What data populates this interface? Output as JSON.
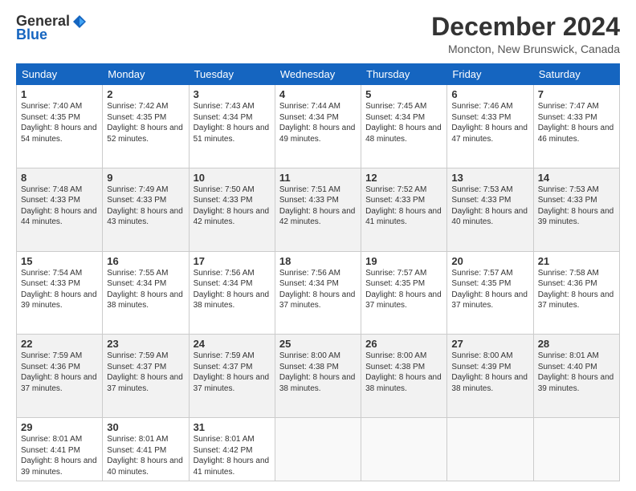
{
  "header": {
    "logo_general": "General",
    "logo_blue": "Blue",
    "title": "December 2024",
    "subtitle": "Moncton, New Brunswick, Canada"
  },
  "calendar": {
    "days_of_week": [
      "Sunday",
      "Monday",
      "Tuesday",
      "Wednesday",
      "Thursday",
      "Friday",
      "Saturday"
    ],
    "weeks": [
      [
        {
          "day": "1",
          "sunrise": "7:40 AM",
          "sunset": "4:35 PM",
          "daylight": "8 hours and 54 minutes."
        },
        {
          "day": "2",
          "sunrise": "7:42 AM",
          "sunset": "4:35 PM",
          "daylight": "8 hours and 52 minutes."
        },
        {
          "day": "3",
          "sunrise": "7:43 AM",
          "sunset": "4:34 PM",
          "daylight": "8 hours and 51 minutes."
        },
        {
          "day": "4",
          "sunrise": "7:44 AM",
          "sunset": "4:34 PM",
          "daylight": "8 hours and 49 minutes."
        },
        {
          "day": "5",
          "sunrise": "7:45 AM",
          "sunset": "4:34 PM",
          "daylight": "8 hours and 48 minutes."
        },
        {
          "day": "6",
          "sunrise": "7:46 AM",
          "sunset": "4:33 PM",
          "daylight": "8 hours and 47 minutes."
        },
        {
          "day": "7",
          "sunrise": "7:47 AM",
          "sunset": "4:33 PM",
          "daylight": "8 hours and 46 minutes."
        }
      ],
      [
        {
          "day": "8",
          "sunrise": "7:48 AM",
          "sunset": "4:33 PM",
          "daylight": "8 hours and 44 minutes."
        },
        {
          "day": "9",
          "sunrise": "7:49 AM",
          "sunset": "4:33 PM",
          "daylight": "8 hours and 43 minutes."
        },
        {
          "day": "10",
          "sunrise": "7:50 AM",
          "sunset": "4:33 PM",
          "daylight": "8 hours and 42 minutes."
        },
        {
          "day": "11",
          "sunrise": "7:51 AM",
          "sunset": "4:33 PM",
          "daylight": "8 hours and 42 minutes."
        },
        {
          "day": "12",
          "sunrise": "7:52 AM",
          "sunset": "4:33 PM",
          "daylight": "8 hours and 41 minutes."
        },
        {
          "day": "13",
          "sunrise": "7:53 AM",
          "sunset": "4:33 PM",
          "daylight": "8 hours and 40 minutes."
        },
        {
          "day": "14",
          "sunrise": "7:53 AM",
          "sunset": "4:33 PM",
          "daylight": "8 hours and 39 minutes."
        }
      ],
      [
        {
          "day": "15",
          "sunrise": "7:54 AM",
          "sunset": "4:33 PM",
          "daylight": "8 hours and 39 minutes."
        },
        {
          "day": "16",
          "sunrise": "7:55 AM",
          "sunset": "4:34 PM",
          "daylight": "8 hours and 38 minutes."
        },
        {
          "day": "17",
          "sunrise": "7:56 AM",
          "sunset": "4:34 PM",
          "daylight": "8 hours and 38 minutes."
        },
        {
          "day": "18",
          "sunrise": "7:56 AM",
          "sunset": "4:34 PM",
          "daylight": "8 hours and 37 minutes."
        },
        {
          "day": "19",
          "sunrise": "7:57 AM",
          "sunset": "4:35 PM",
          "daylight": "8 hours and 37 minutes."
        },
        {
          "day": "20",
          "sunrise": "7:57 AM",
          "sunset": "4:35 PM",
          "daylight": "8 hours and 37 minutes."
        },
        {
          "day": "21",
          "sunrise": "7:58 AM",
          "sunset": "4:36 PM",
          "daylight": "8 hours and 37 minutes."
        }
      ],
      [
        {
          "day": "22",
          "sunrise": "7:59 AM",
          "sunset": "4:36 PM",
          "daylight": "8 hours and 37 minutes."
        },
        {
          "day": "23",
          "sunrise": "7:59 AM",
          "sunset": "4:37 PM",
          "daylight": "8 hours and 37 minutes."
        },
        {
          "day": "24",
          "sunrise": "7:59 AM",
          "sunset": "4:37 PM",
          "daylight": "8 hours and 37 minutes."
        },
        {
          "day": "25",
          "sunrise": "8:00 AM",
          "sunset": "4:38 PM",
          "daylight": "8 hours and 38 minutes."
        },
        {
          "day": "26",
          "sunrise": "8:00 AM",
          "sunset": "4:38 PM",
          "daylight": "8 hours and 38 minutes."
        },
        {
          "day": "27",
          "sunrise": "8:00 AM",
          "sunset": "4:39 PM",
          "daylight": "8 hours and 38 minutes."
        },
        {
          "day": "28",
          "sunrise": "8:01 AM",
          "sunset": "4:40 PM",
          "daylight": "8 hours and 39 minutes."
        }
      ],
      [
        {
          "day": "29",
          "sunrise": "8:01 AM",
          "sunset": "4:41 PM",
          "daylight": "8 hours and 39 minutes."
        },
        {
          "day": "30",
          "sunrise": "8:01 AM",
          "sunset": "4:41 PM",
          "daylight": "8 hours and 40 minutes."
        },
        {
          "day": "31",
          "sunrise": "8:01 AM",
          "sunset": "4:42 PM",
          "daylight": "8 hours and 41 minutes."
        },
        null,
        null,
        null,
        null
      ]
    ]
  }
}
